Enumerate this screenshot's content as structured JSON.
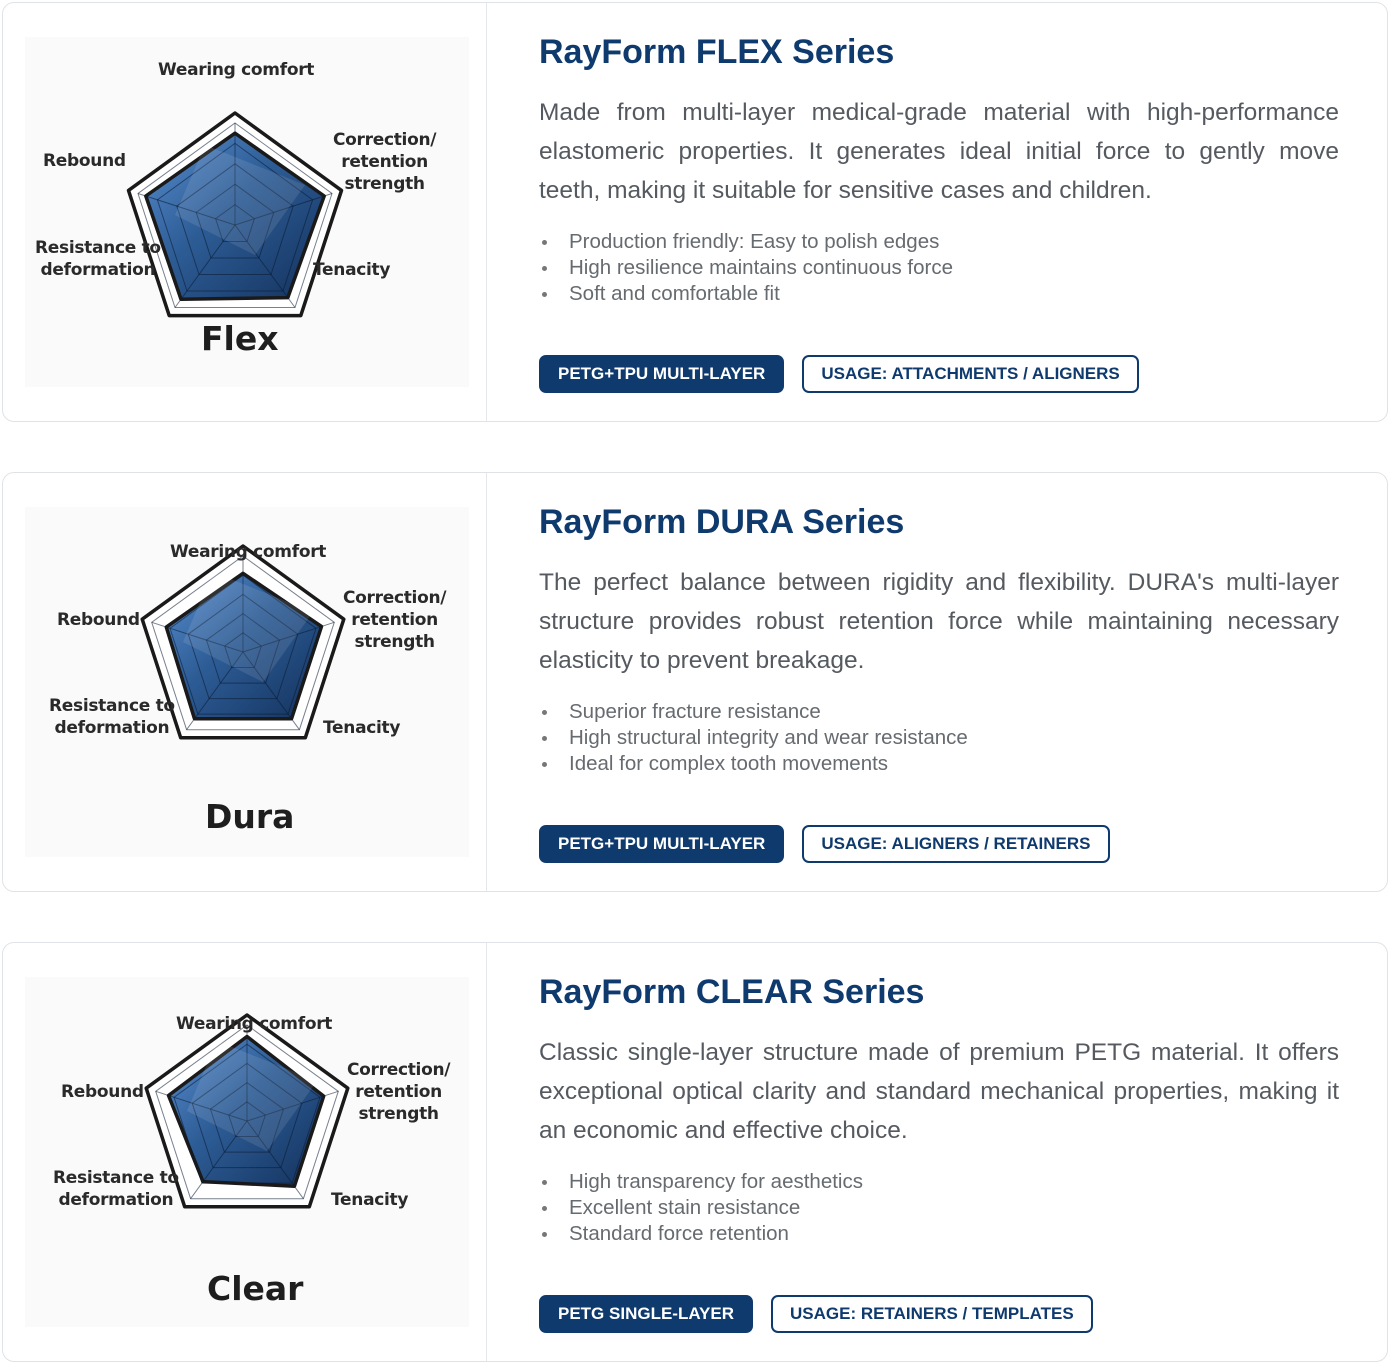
{
  "colors": {
    "brand_navy": "#0f3a6e",
    "card_border": "#dfe3e8",
    "radar_fill": "#2d5c95",
    "radar_outline": "#1a1a1a"
  },
  "products": [
    {
      "title": "RayForm FLEX Series",
      "description": "Made from multi-layer medical-grade material with high-performance elastomeric properties. It generates ideal initial force to gently move teeth, making it suitable for sensitive cases and children.",
      "features": [
        "Production friendly: Easy to polish edges",
        "High resilience maintains continuous force",
        "Soft and comfortable fit"
      ],
      "material_tag": "PETG+TPU MULTI-LAYER",
      "usage_tag": "USAGE: ATTACHMENTS / ALIGNERS",
      "chart": {
        "name": "Flex",
        "axes": [
          "Wearing comfort",
          "Correction/ retention strength",
          "Tenacity",
          "Resistance to deformation",
          "Rebound"
        ],
        "axis_labels": {
          "top": "Wearing comfort",
          "right": [
            "Correction/",
            "retention",
            "strength"
          ],
          "bottom_right": "Tenacity",
          "bottom_left": [
            "Resistance to",
            "deformation"
          ],
          "left": "Rebound"
        },
        "values": [
          0.9,
          0.92,
          0.88,
          0.9,
          0.92
        ]
      }
    },
    {
      "title": "RayForm DURA Series",
      "description": "The perfect balance between rigidity and flexibility. DURA's multi-layer structure provides robust retention force while maintaining necessary elasticity to prevent breakage.",
      "features": [
        "Superior fracture resistance",
        "High structural integrity and wear resistance",
        "Ideal for complex tooth movements"
      ],
      "material_tag": "PETG+TPU MULTI-LAYER",
      "usage_tag": "USAGE: ALIGNERS / RETAINERS",
      "chart": {
        "name": "Dura",
        "axes": [
          "Wearing comfort",
          "Correction/ retention strength",
          "Tenacity",
          "Resistance to deformation",
          "Rebound"
        ],
        "axis_labels": {
          "top": "Wearing comfort",
          "right": [
            "Correction/",
            "retention",
            "strength"
          ],
          "bottom_right": "Tenacity",
          "bottom_left": [
            "Resistance to",
            "deformation"
          ],
          "left": "Rebound"
        },
        "values": [
          0.82,
          0.86,
          0.86,
          0.86,
          0.84
        ]
      }
    },
    {
      "title": "RayForm CLEAR Series",
      "description": "Classic single-layer structure made of premium PETG material. It offers exceptional optical clarity and standard mechanical properties, making it an economic and effective choice.",
      "features": [
        "High transparency for aesthetics",
        "Excellent stain resistance",
        "Standard force retention"
      ],
      "material_tag": "PETG SINGLE-LAYER",
      "usage_tag": "USAGE: RETAINERS / TEMPLATES",
      "chart": {
        "name": "Clear",
        "axes": [
          "Wearing comfort",
          "Correction/ retention strength",
          "Tenacity",
          "Resistance to deformation",
          "Rebound"
        ],
        "axis_labels": {
          "top": "Wearing comfort",
          "right": [
            "Correction/",
            "retention",
            "strength"
          ],
          "bottom_right": "Tenacity",
          "bottom_left": [
            "Resistance to",
            "deformation"
          ],
          "left": "Rebound"
        },
        "values": [
          0.88,
          0.84,
          0.84,
          0.78,
          0.86
        ]
      }
    }
  ]
}
